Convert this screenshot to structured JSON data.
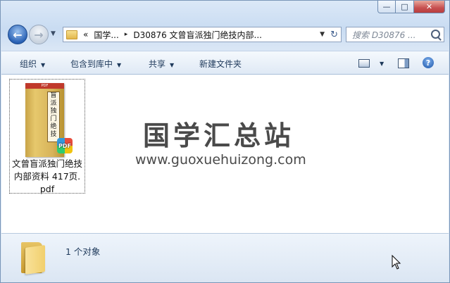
{
  "window": {
    "caption_buttons": {
      "minimize": "—",
      "maximize": "□",
      "close": "✕"
    }
  },
  "nav": {
    "back_glyph": "←",
    "forward_glyph": "→",
    "history_glyph": "▼",
    "breadcrumb": [
      "«",
      "国学...",
      "▸",
      "D30876 文曾盲派独门绝技内部..."
    ],
    "dropdown_glyph": "▼",
    "refresh_glyph": "↻",
    "search_placeholder": "搜索 D30876 ..."
  },
  "toolbar": {
    "items": [
      "组织",
      "包含到库中",
      "共享",
      "新建文件夹"
    ],
    "dropdown_glyph": "▼",
    "help_glyph": "?"
  },
  "content": {
    "file": {
      "name": "文曾盲派独门绝技内部资料 417页.pdf",
      "name_lines": [
        "文曾盲派独门绝技",
        "内部资料 417页.",
        "pdf"
      ],
      "thumb_top": "PDF",
      "thumb_label": "盲派独门绝技",
      "badge": "PDF"
    },
    "watermark": {
      "text": "国学汇总站",
      "url": "www.guoxuehuizong.com"
    }
  },
  "details": {
    "count": "1 个对象"
  },
  "icons": {
    "folder": "folder-icon",
    "search": "search-icon",
    "help": "help-icon",
    "view": "view-icon",
    "preview_pane": "preview-pane-icon",
    "cursor": "mouse-cursor-icon"
  }
}
